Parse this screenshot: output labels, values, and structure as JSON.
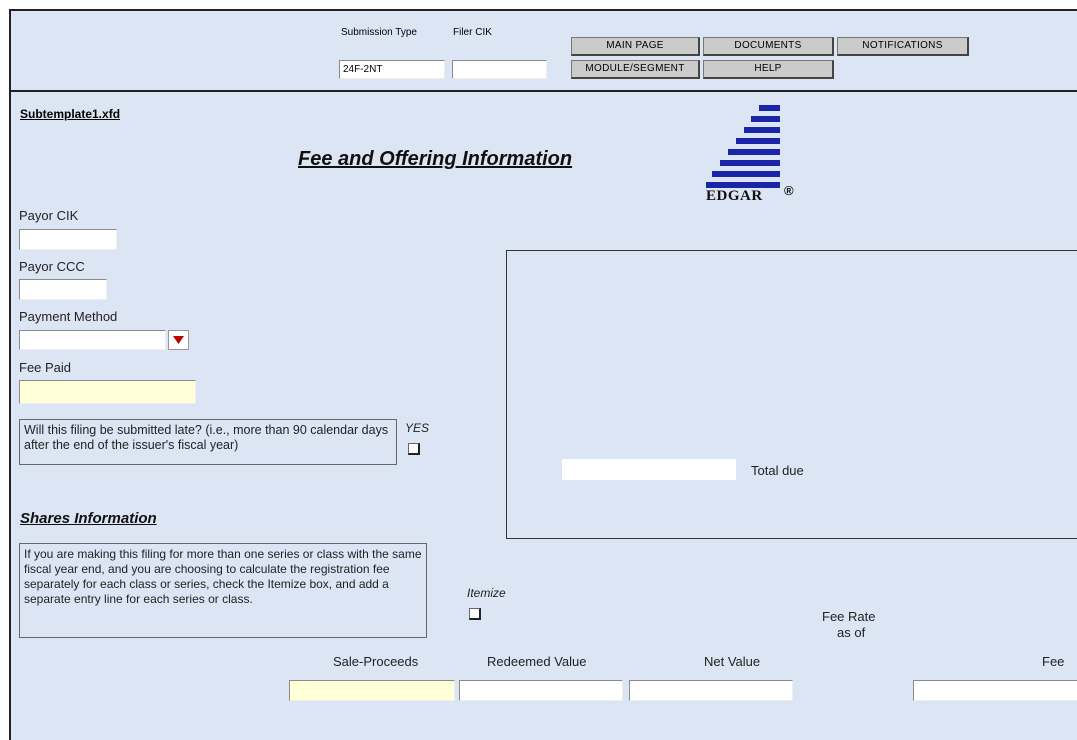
{
  "header": {
    "submission_type_label": "Submission Type",
    "submission_type_value": "24F-2NT",
    "filer_cik_label": "Filer CIK",
    "filer_cik_value": "",
    "nav": {
      "main_page": "MAIN PAGE",
      "documents": "DOCUMENTS",
      "notifications": "NOTIFICATIONS",
      "module_segment": "MODULE/SEGMENT",
      "help": "HELP"
    }
  },
  "form": {
    "template_name": "Subtemplate1.xfd",
    "title": "Fee and Offering Information",
    "logo_text": "EDGAR",
    "logo_mark": "®",
    "payor_cik_label": "Payor CIK",
    "payor_cik_value": "",
    "payor_ccc_label": "Payor CCC",
    "payor_ccc_value": "",
    "payment_method_label": "Payment Method",
    "payment_method_value": "",
    "fee_paid_label": "Fee Paid",
    "fee_paid_value": "",
    "late_question": "Will this filing be submitted late? (i.e., more than 90 calendar days after the end of the issuer's fiscal year)",
    "late_yes_label": "YES",
    "total_due_label": "Total due",
    "total_due_value": ""
  },
  "shares": {
    "heading": "Shares Information",
    "note": "If you are making this filing for more than one series or class with the same fiscal year end, and you are choosing to calculate the registration fee separately for each class or series, check the Itemize box, and add a separate entry line for each series or class.",
    "itemize_label": "Itemize",
    "fee_rate_label_1": "Fee Rate",
    "fee_rate_label_2": "as of",
    "columns": {
      "sale_proceeds": "Sale-Proceeds",
      "redeemed_value": "Redeemed Value",
      "net_value": "Net Value",
      "fee": "Fee"
    },
    "row": {
      "sale_proceeds": "",
      "redeemed_value": "",
      "net_value": "",
      "fee": ""
    }
  },
  "colors": {
    "panel_background": "#dce5f4",
    "required_field": "#ffffd8",
    "logo_blue": "#1a25a8",
    "dropdown_arrow": "#c00000"
  }
}
